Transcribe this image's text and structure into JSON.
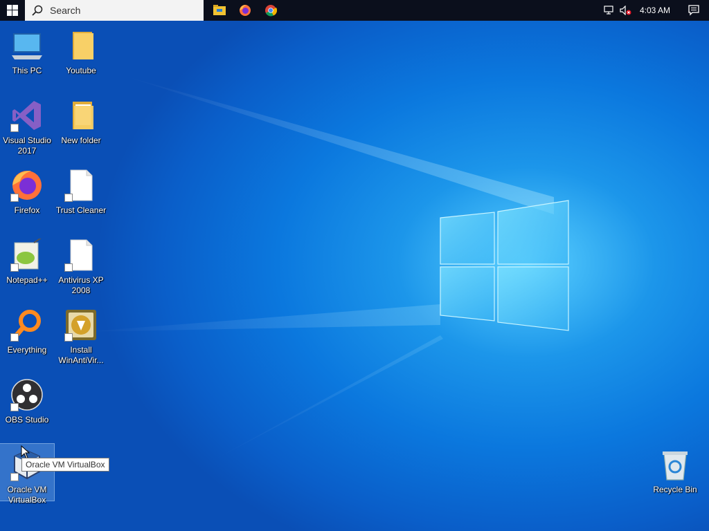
{
  "taskbar": {
    "search_placeholder": "Search",
    "pinned": [
      {
        "name": "file-explorer-icon"
      },
      {
        "name": "firefox-icon"
      },
      {
        "name": "chrome-icon"
      }
    ],
    "clock": "4:03 AM"
  },
  "desktop": {
    "icons": [
      {
        "label": "This PC",
        "icon": "this-pc-icon"
      },
      {
        "label": "Youtube",
        "icon": "folder-icon"
      },
      {
        "label": "Visual Studio 2017",
        "icon": "visual-studio-icon"
      },
      {
        "label": "New folder",
        "icon": "folder-icon"
      },
      {
        "label": "Firefox",
        "icon": "firefox-icon"
      },
      {
        "label": "Trust Cleaner",
        "icon": "file-icon"
      },
      {
        "label": "Notepad++",
        "icon": "notepad-plus-plus-icon"
      },
      {
        "label": "Antivirus XP 2008",
        "icon": "file-icon"
      },
      {
        "label": "Everything",
        "icon": "everything-search-icon"
      },
      {
        "label": "Install WinAntiVir...",
        "icon": "installer-icon"
      },
      {
        "label": "OBS Studio",
        "icon": "obs-icon"
      },
      {
        "label": "Oracle VM VirtualBox",
        "icon": "virtualbox-icon"
      },
      {
        "label": "Recycle Bin",
        "icon": "recycle-bin-icon"
      }
    ],
    "tooltip": "Oracle VM VirtualBox"
  },
  "colors": {
    "taskbar": "#0b0f1c",
    "wallpaper_accent": "#1c96ea"
  }
}
